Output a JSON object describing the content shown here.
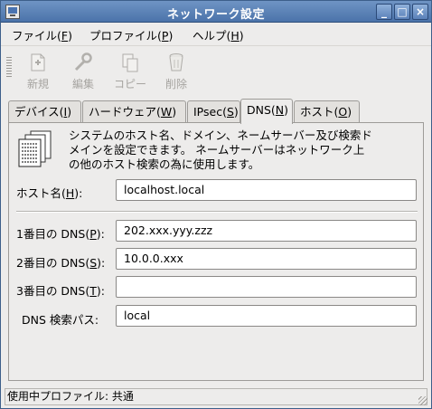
{
  "window": {
    "title": "ネットワーク設定",
    "min_glyph": "_",
    "max_glyph": "□",
    "close_glyph": "×"
  },
  "menu": [
    {
      "label": "ファイル(",
      "key": "F",
      "tail": ")"
    },
    {
      "label": "プロファイル(",
      "key": "P",
      "tail": ")"
    },
    {
      "label": "ヘルプ(",
      "key": "H",
      "tail": ")"
    }
  ],
  "toolbar": [
    {
      "label": "新規",
      "icon": "new-document-icon"
    },
    {
      "label": "編集",
      "icon": "wrench-icon"
    },
    {
      "label": "コピー",
      "icon": "copy-icon"
    },
    {
      "label": "削除",
      "icon": "trash-icon"
    }
  ],
  "tabs": [
    {
      "label": "デバイス(",
      "key": "I",
      "tail": ")"
    },
    {
      "label": "ハードウェア(",
      "key": "W",
      "tail": ")"
    },
    {
      "label": "IPsec(",
      "key": "S",
      "tail": ")"
    },
    {
      "label": "DNS(",
      "key": "N",
      "tail": ")"
    },
    {
      "label": "ホスト(",
      "key": "O",
      "tail": ")"
    }
  ],
  "dns": {
    "description": [
      "システムのホスト名、ドメイン、ネームサーバー及び検索ド",
      "メインを設定できます。 ネームサーバーはネットワーク上",
      "の他のホスト検索の為に使用します。"
    ],
    "hostname": {
      "label": "ホスト名(",
      "key": "H",
      "tail": "):",
      "value": "localhost.local"
    },
    "dns1": {
      "label": "1番目の  DNS(",
      "key": "P",
      "tail": "):",
      "value": "202.xxx.yyy.zzz"
    },
    "dns2": {
      "label": "2番目の  DNS(",
      "key": "S",
      "tail": "):",
      "value": "10.0.0.xxx"
    },
    "dns3": {
      "label": "3番目の  DNS(",
      "key": "T",
      "tail": "):",
      "value": ""
    },
    "search": {
      "label": "DNS 検索パス:",
      "value": "local"
    }
  },
  "status": {
    "text": "使用中プロファイル:  共通"
  }
}
